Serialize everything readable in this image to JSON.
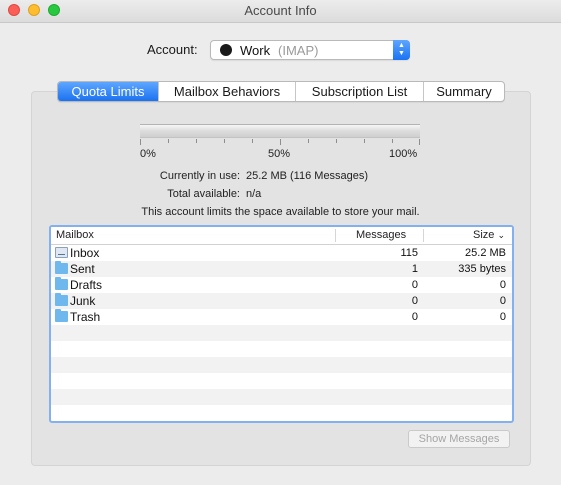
{
  "window": {
    "title": "Account Info"
  },
  "account": {
    "label": "Account:",
    "name": "Work",
    "type": "(IMAP)"
  },
  "tabs": [
    {
      "label": "Quota Limits",
      "active": true
    },
    {
      "label": "Mailbox Behaviors",
      "active": false
    },
    {
      "label": "Subscription List",
      "active": false
    },
    {
      "label": "Summary",
      "active": false
    }
  ],
  "quota": {
    "usage_fraction": 0,
    "ticks": [
      "0%",
      "50%",
      "100%"
    ],
    "in_use_label": "Currently in use:",
    "in_use_value": "25.2 MB (116 Messages)",
    "available_label": "Total available:",
    "available_value": "n/a",
    "notice": "This account limits the space available to store your mail."
  },
  "table": {
    "columns": {
      "mailbox": "Mailbox",
      "messages": "Messages",
      "size": "Size"
    },
    "rows": [
      {
        "icon": "inbox-icon",
        "name": "Inbox",
        "messages": "115",
        "size": "25.2 MB"
      },
      {
        "icon": "folder-icon",
        "name": "Sent",
        "messages": "1",
        "size": "335 bytes"
      },
      {
        "icon": "folder-icon",
        "name": "Drafts",
        "messages": "0",
        "size": "0"
      },
      {
        "icon": "folder-icon",
        "name": "Junk",
        "messages": "0",
        "size": "0"
      },
      {
        "icon": "folder-icon",
        "name": "Trash",
        "messages": "0",
        "size": "0"
      }
    ]
  },
  "buttons": {
    "show_messages": "Show Messages"
  },
  "colors": {
    "accent": "#1b72f0",
    "focus_ring": "#82b1ed"
  }
}
